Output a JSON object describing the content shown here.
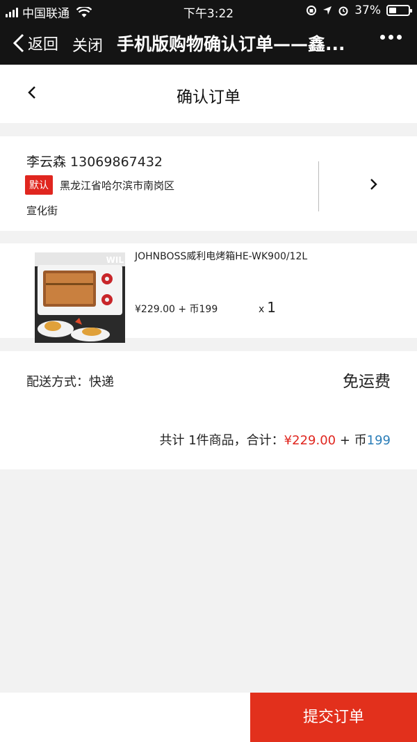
{
  "status_bar": {
    "carrier": "中国联通",
    "time": "下午3:22",
    "battery": "37%",
    "battery_level": 0.37
  },
  "wechat_bar": {
    "back_label": "返回",
    "close_label": "关闭",
    "title": "手机版购物确认订单——鑫..."
  },
  "page": {
    "title": "确认订单"
  },
  "address": {
    "name_phone": "李云森 13069867432",
    "badge": "默认",
    "line1": "黑龙江省哈尔滨市南岗区",
    "line2": "宣化街"
  },
  "product": {
    "name": "JOHNBOSS威利电烤箱HE-WK900/12L",
    "price": "¥229.00 + 币199",
    "qty_prefix": "x",
    "qty": "1",
    "image_brand_text": "WIL"
  },
  "delivery": {
    "label": "配送方式：快递",
    "fee": "免运费"
  },
  "total": {
    "prefix": "共计 1件商品，合计：",
    "price": "¥229.00",
    "plus": " + 币",
    "coins": "199"
  },
  "actions": {
    "submit_label": "提交订单"
  },
  "colors": {
    "accent_red": "#e2301c",
    "coin_blue": "#2a7db8",
    "bar_dark": "#141414"
  }
}
